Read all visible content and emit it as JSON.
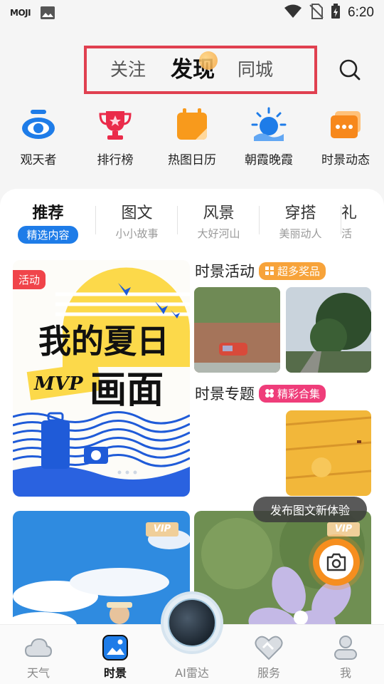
{
  "statusbar": {
    "app_tag": "MOJI",
    "time": "6:20"
  },
  "topnav": {
    "tabs": [
      {
        "label": "关注",
        "active": false
      },
      {
        "label": "发现",
        "active": true
      },
      {
        "label": "同城",
        "active": false
      }
    ],
    "highlight_color": "#e04050"
  },
  "shortcuts": [
    {
      "label": "观天者",
      "icon": "eye-icon"
    },
    {
      "label": "排行榜",
      "icon": "trophy-icon"
    },
    {
      "label": "热图日历",
      "icon": "calendar-icon"
    },
    {
      "label": "朝霞晚霞",
      "icon": "sunrise-icon"
    },
    {
      "label": "时景动态",
      "icon": "chat-cards-icon"
    }
  ],
  "categories": [
    {
      "title": "推荐",
      "subtitle": "精选内容",
      "active": true
    },
    {
      "title": "图文",
      "subtitle": "小小故事",
      "active": false
    },
    {
      "title": "风景",
      "subtitle": "大好河山",
      "active": false
    },
    {
      "title": "穿搭",
      "subtitle": "美丽动人",
      "active": false
    },
    {
      "title": "礼",
      "subtitle": "活",
      "active": false
    }
  ],
  "hero": {
    "badge": "活动",
    "line1": "我的夏日",
    "mvp": "MVP",
    "line2": "画面"
  },
  "activity": {
    "title": "时景活动",
    "pill": "超多奖品"
  },
  "topic": {
    "title": "时景专题",
    "pill": "精彩合集"
  },
  "cards": [
    {
      "badge": "VIP"
    },
    {
      "badge": "VIP"
    }
  ],
  "tooltip": "发布图文新体验",
  "bottom_nav": [
    {
      "label": "天气",
      "icon": "cloud-icon",
      "active": false
    },
    {
      "label": "时景",
      "icon": "picture-icon",
      "active": true
    },
    {
      "label": "AI雷达",
      "icon": "radar-icon",
      "active": false
    },
    {
      "label": "服务",
      "icon": "handshake-icon",
      "active": false
    },
    {
      "label": "我",
      "icon": "person-icon",
      "active": false
    }
  ],
  "colors": {
    "accent_blue": "#1e7ce8",
    "orange": "#f68e1e",
    "pink": "#ef3d7a"
  }
}
